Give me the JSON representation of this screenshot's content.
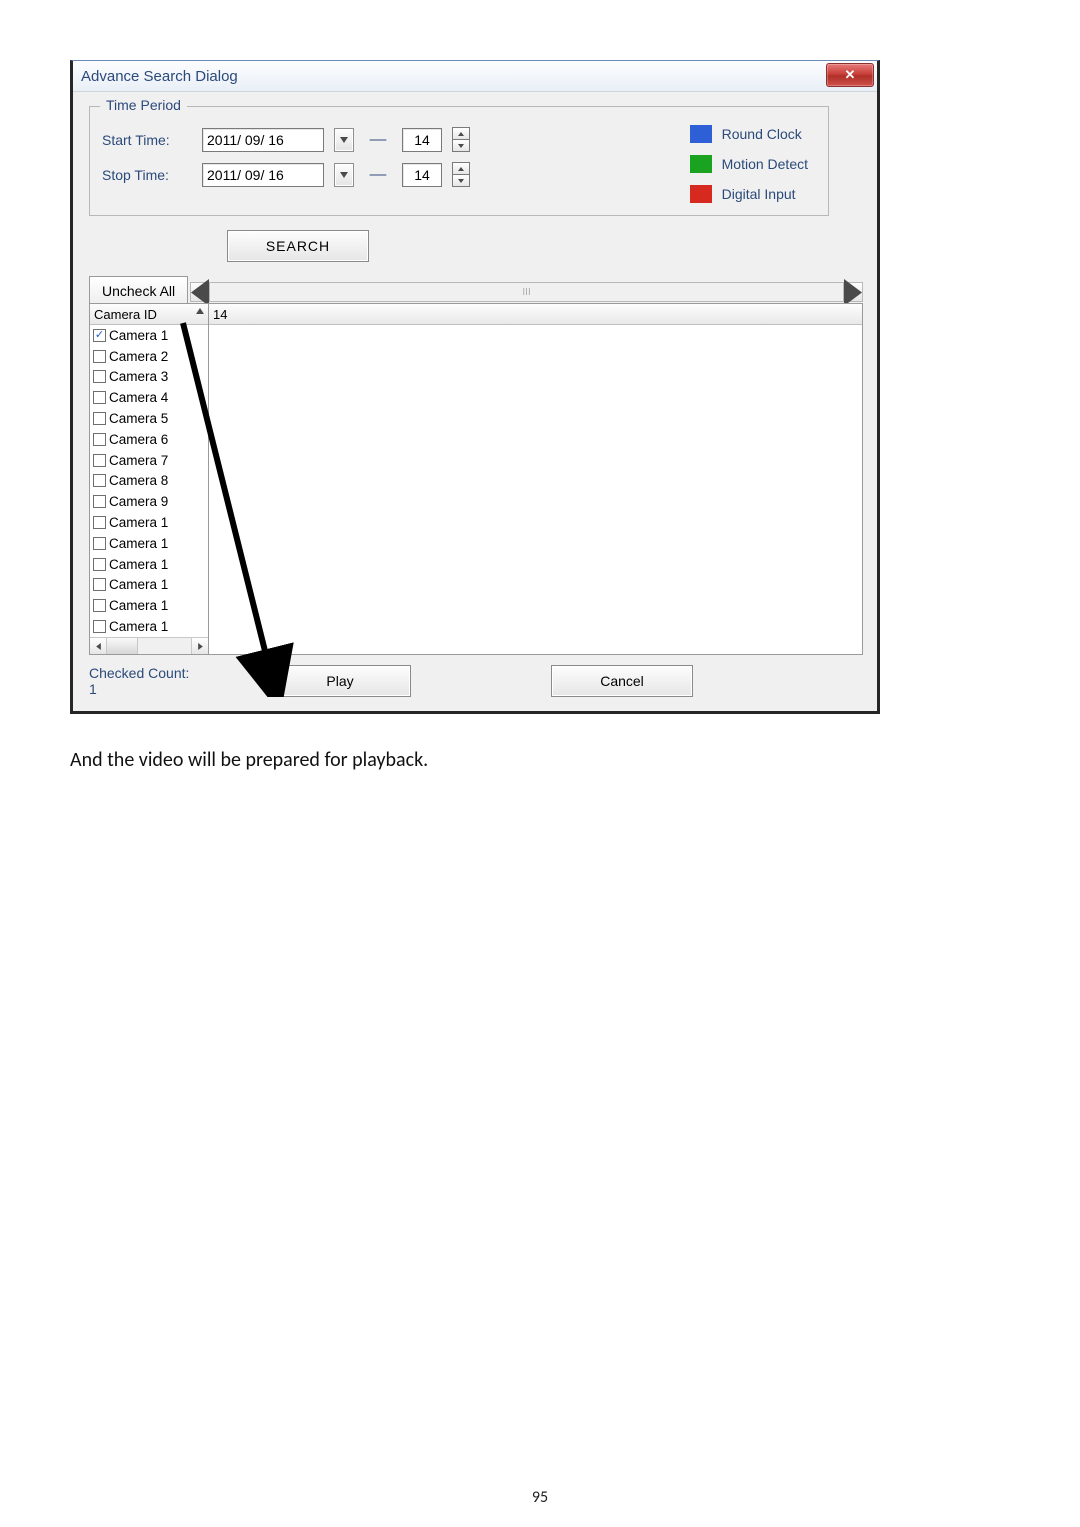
{
  "dialog": {
    "title": "Advance Search Dialog",
    "time_period": {
      "legend": "Time Period",
      "start_label": "Start Time:",
      "stop_label": "Stop Time:",
      "start_date": "2011/ 09/ 16",
      "stop_date": "2011/ 09/ 16",
      "start_hour": "14",
      "stop_hour": "14"
    },
    "legend_items": {
      "round_clock": "Round Clock",
      "motion_detect": "Motion Detect",
      "digital_input": "Digital Input"
    },
    "search_label": "SEARCH",
    "uncheck_all_tab": "Uncheck All",
    "scroll_marker": "III",
    "columns": {
      "id": "Camera ID",
      "col14": "14"
    },
    "cameras": [
      {
        "label": "Camera 1",
        "checked": true
      },
      {
        "label": "Camera 2",
        "checked": false
      },
      {
        "label": "Camera 3",
        "checked": false
      },
      {
        "label": "Camera 4",
        "checked": false
      },
      {
        "label": "Camera 5",
        "checked": false
      },
      {
        "label": "Camera 6",
        "checked": false
      },
      {
        "label": "Camera 7",
        "checked": false
      },
      {
        "label": "Camera 8",
        "checked": false
      },
      {
        "label": "Camera 9",
        "checked": false
      },
      {
        "label": "Camera 1",
        "checked": false
      },
      {
        "label": "Camera 1",
        "checked": false
      },
      {
        "label": "Camera 1",
        "checked": false
      },
      {
        "label": "Camera 1",
        "checked": false
      },
      {
        "label": "Camera 1",
        "checked": false
      },
      {
        "label": "Camera 1",
        "checked": false
      }
    ],
    "checked_count_label": "Checked Count:",
    "checked_count_value": "1",
    "play_label": "Play",
    "cancel_label": "Cancel"
  },
  "caption": "And the video will be prepared for playback.",
  "page_number": "95"
}
